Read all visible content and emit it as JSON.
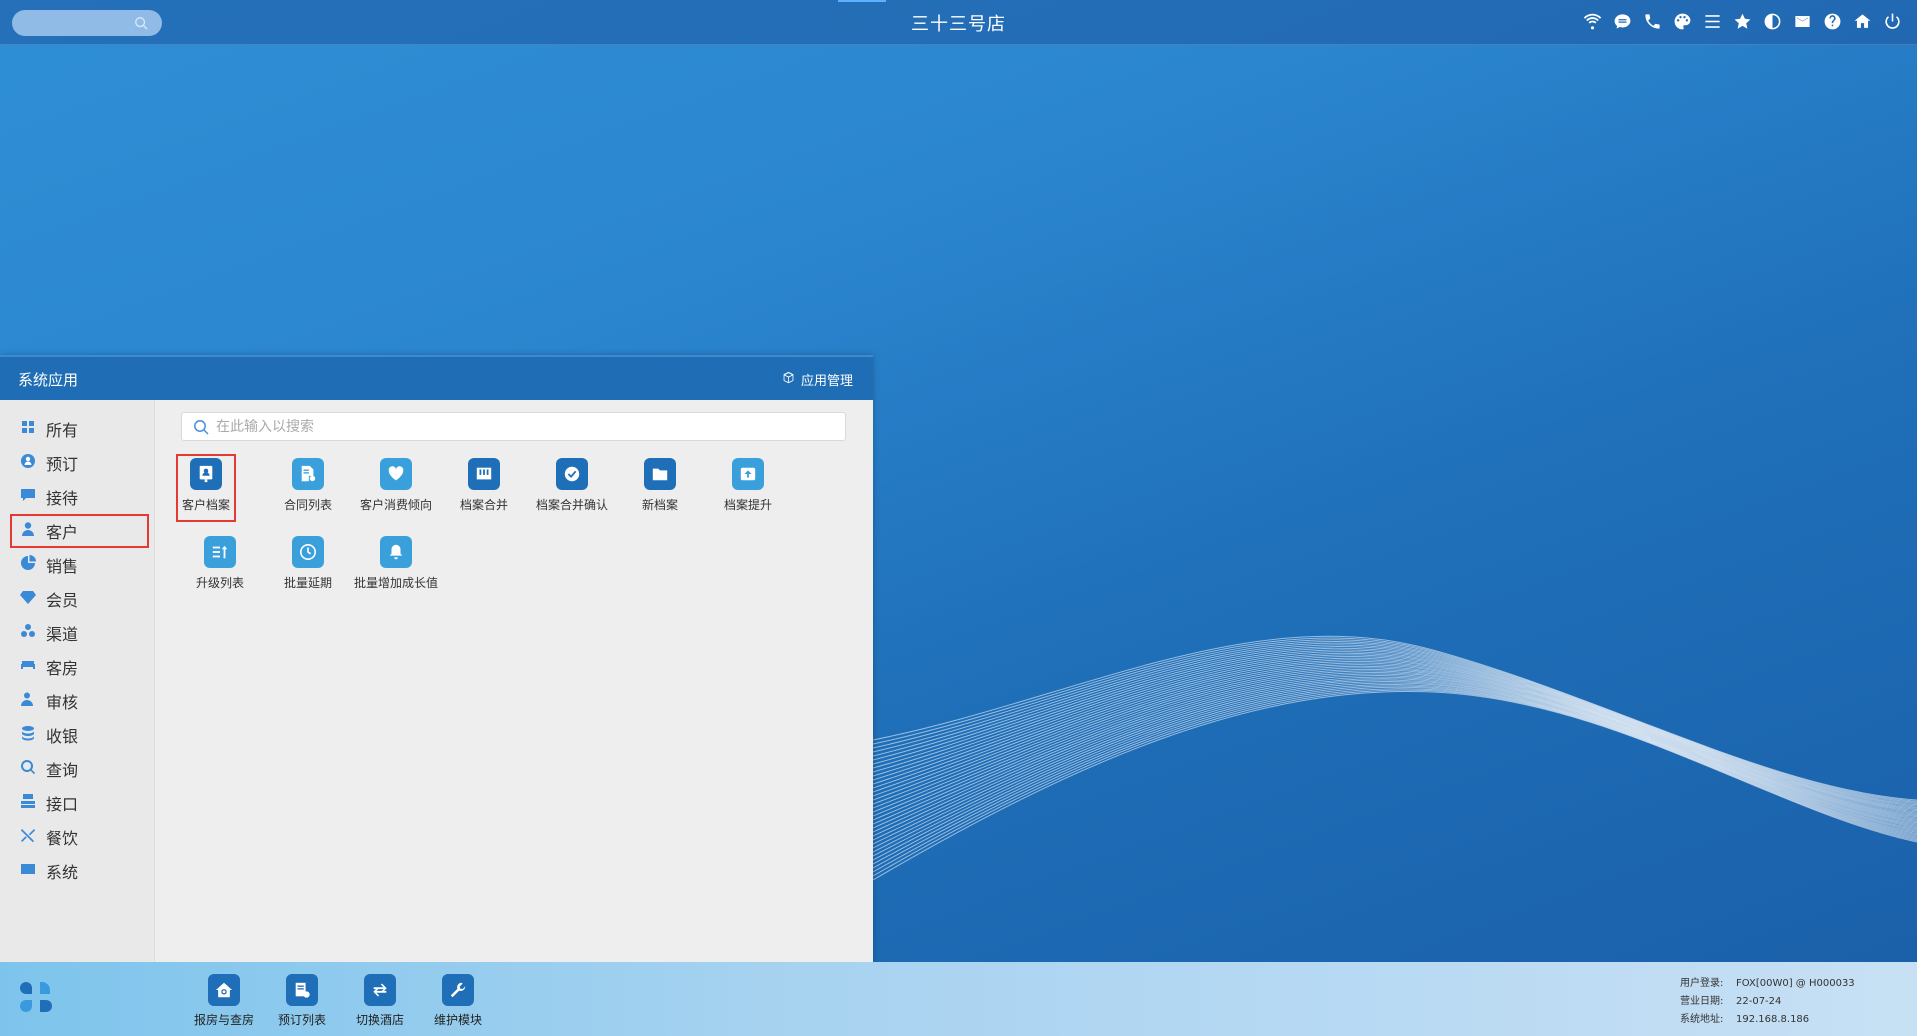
{
  "topbar": {
    "title": "三十三号店",
    "icons": [
      "wifi-icon",
      "chat-icon",
      "phone-icon",
      "palette-icon",
      "menu-icon",
      "star-icon",
      "contrast-icon",
      "mail-icon",
      "help-icon",
      "home-icon",
      "power-icon"
    ]
  },
  "panel": {
    "title": "系统应用",
    "app_manage_label": "应用管理",
    "search_placeholder": "在此输入以搜索",
    "sidebar": [
      {
        "label": "所有",
        "icon": "grid-icon"
      },
      {
        "label": "预订",
        "icon": "booking-icon"
      },
      {
        "label": "接待",
        "icon": "reception-icon"
      },
      {
        "label": "客户",
        "icon": "customer-icon",
        "selected": true
      },
      {
        "label": "销售",
        "icon": "sales-icon"
      },
      {
        "label": "会员",
        "icon": "member-icon"
      },
      {
        "label": "渠道",
        "icon": "channel-icon"
      },
      {
        "label": "客房",
        "icon": "room-icon"
      },
      {
        "label": "审核",
        "icon": "audit-icon"
      },
      {
        "label": "收银",
        "icon": "cashier-icon"
      },
      {
        "label": "查询",
        "icon": "query-icon"
      },
      {
        "label": "接口",
        "icon": "interface-icon"
      },
      {
        "label": "餐饮",
        "icon": "dining-icon"
      },
      {
        "label": "系统",
        "icon": "system-icon"
      }
    ],
    "apps": [
      {
        "label": "客户档案",
        "icon": "customer-profile-icon",
        "color": "#1f6fb8",
        "highlight": true
      },
      {
        "label": "合同列表",
        "icon": "contract-list-icon",
        "color": "#3aa0db"
      },
      {
        "label": "客户消费倾向",
        "icon": "heart-icon",
        "color": "#3aa0db"
      },
      {
        "label": "档案合并",
        "icon": "merge-icon",
        "color": "#1f6fb8"
      },
      {
        "label": "档案合并确认",
        "icon": "check-icon",
        "color": "#1f6fb8"
      },
      {
        "label": "新档案",
        "icon": "folder-icon",
        "color": "#1f6fb8"
      },
      {
        "label": "档案提升",
        "icon": "upgrade-box-icon",
        "color": "#3aa0db"
      },
      {
        "label": "升级列表",
        "icon": "sort-list-icon",
        "color": "#3aa0db"
      },
      {
        "label": "批量延期",
        "icon": "clock-icon",
        "color": "#3aa0db"
      },
      {
        "label": "批量增加成长值",
        "icon": "bell-icon",
        "color": "#3aa0db"
      }
    ]
  },
  "taskbar": {
    "apps": [
      {
        "label": "报房与查房",
        "icon": "house-search-icon"
      },
      {
        "label": "预订列表",
        "icon": "booking-list-icon"
      },
      {
        "label": "切换酒店",
        "icon": "switch-icon"
      },
      {
        "label": "维护模块",
        "icon": "wrench-icon"
      }
    ],
    "info": {
      "user_label": "用户登录:",
      "user_value": "FOX[00W0] @ H000033",
      "date_label": "营业日期:",
      "date_value": "22-07-24",
      "address_label": "系统地址:",
      "address_value": "192.168.8.186"
    }
  }
}
